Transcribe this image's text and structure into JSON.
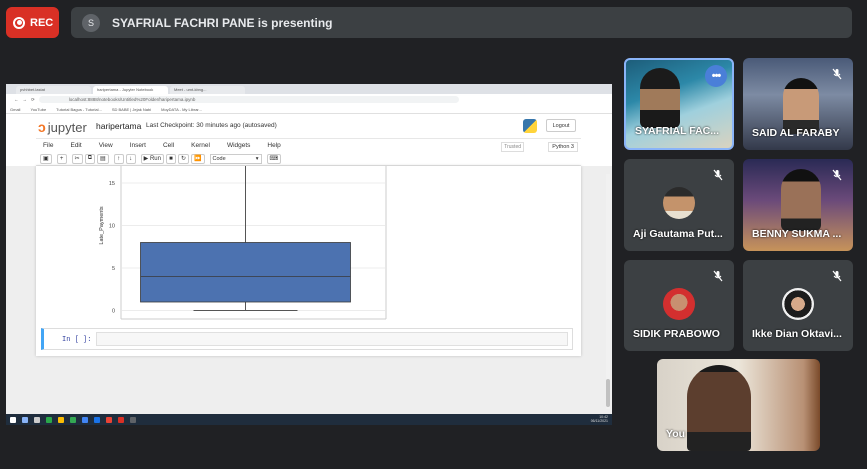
{
  "recording": {
    "label": "REC"
  },
  "presenter_bar": {
    "avatar_initial": "S",
    "text": "SYAFRIAL FACHRI PANE is presenting"
  },
  "browser": {
    "tabs": [
      "pvhhbet.lastat",
      "haripertama - Jupyter Notebook",
      "Meet - umt-kbng..."
    ],
    "url": "localhost:8888/notebooks/Untitled%20Folder/haripertama.ipynb",
    "bookmarks": [
      "Gmail",
      "YouTube",
      "Tutorial Bagus - Tutorial...",
      "SD BABE | Jejak Nabi",
      "MoyDATA - My Librar..."
    ]
  },
  "jupyter": {
    "logo_text": "jupyter",
    "notebook_name": "haripertama",
    "checkpoint": "Last Checkpoint: 30 minutes ago  (autosaved)",
    "logout": "Logout",
    "menu": [
      "File",
      "Edit",
      "View",
      "Insert",
      "Cell",
      "Kernel",
      "Widgets",
      "Help"
    ],
    "trusted": "Trusted",
    "kernel": "Python 3",
    "toolbar": {
      "run": "Run",
      "cell_type": "Code"
    },
    "input_prompt": "In [ ]:"
  },
  "chart_data": {
    "type": "box",
    "ylabel": "Late_Payments",
    "yticks": [
      0,
      5,
      10,
      15
    ],
    "ylim": [
      -1,
      17
    ],
    "box": {
      "whisker_low": 0,
      "q1": 1,
      "median": 4,
      "q3": 8,
      "whisker_high": 17
    }
  },
  "taskbar": {
    "time": "10:42",
    "date": "06/11/2021"
  },
  "participants": [
    {
      "name": "SYAFRIAL FAC...",
      "muted": false,
      "has_more": true
    },
    {
      "name": "SAID AL FARABY",
      "muted": true
    },
    {
      "name": "Aji Gautama Put...",
      "muted": true
    },
    {
      "name": "BENNY SUKMA ...",
      "muted": true
    },
    {
      "name": "SIDIK PRABOWO",
      "muted": true
    },
    {
      "name": "Ikke Dian Oktavi...",
      "muted": true
    },
    {
      "name": "You",
      "muted": false
    }
  ],
  "colors": {
    "rec": "#d93025",
    "box_fill": "#4c72b0",
    "bg": "#202124",
    "tile": "#3c4043"
  }
}
